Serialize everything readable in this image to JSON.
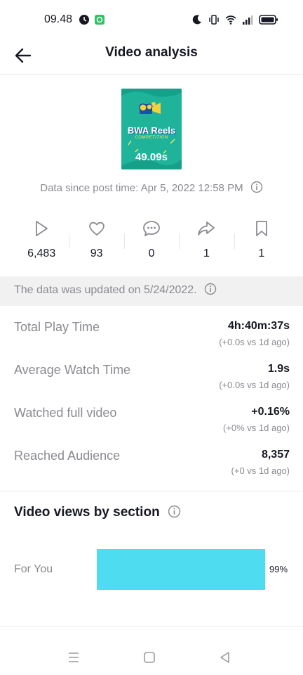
{
  "status_bar": {
    "time": "09.48",
    "left_icons": [
      "alarm-icon",
      "app-notification-icon"
    ],
    "right_icons": [
      "moon-icon",
      "vibrate-icon",
      "wifi-icon",
      "signal-icon",
      "battery-icon"
    ]
  },
  "header": {
    "title": "Video analysis",
    "back_icon": "arrow-left-icon"
  },
  "video": {
    "thumbnail_title": "BWA Reels",
    "thumbnail_subtitle": "COMPETITION",
    "duration": "49.09s"
  },
  "post_time_text": "Data since post time: Apr 5, 2022 12:58 PM",
  "stats": [
    {
      "icon": "play-icon",
      "value": "6,483"
    },
    {
      "icon": "heart-icon",
      "value": "93"
    },
    {
      "icon": "comment-icon",
      "value": "0"
    },
    {
      "icon": "share-icon",
      "value": "1"
    },
    {
      "icon": "bookmark-icon",
      "value": "1"
    }
  ],
  "update_banner": "The data was updated on 5/24/2022.",
  "metrics": [
    {
      "label": "Total Play Time",
      "value": "4h:40m:37s",
      "compare": "(+0.0s vs 1d ago)"
    },
    {
      "label": "Average Watch Time",
      "value": "1.9s",
      "compare": "(+0.0s vs 1d ago)"
    },
    {
      "label": "Watched full video",
      "value": "+0.16%",
      "compare": "(+0% vs 1d ago)"
    },
    {
      "label": "Reached Audience",
      "value": "8,357",
      "compare": "(+0 vs 1d ago)"
    }
  ],
  "views_section": {
    "title": "Video views by section",
    "rows": [
      {
        "label": "For You",
        "percent_label": "99%",
        "fraction": 0.99
      }
    ]
  },
  "colors": {
    "bar": "#4ddcf0",
    "thumbnail_bg": "#1fb39a",
    "secondary_text": "#8a8b91",
    "banner_bg": "#f1f1f2"
  },
  "nav_bar": {
    "icons": [
      "menu-icon",
      "home-icon",
      "back-triangle-icon"
    ]
  }
}
